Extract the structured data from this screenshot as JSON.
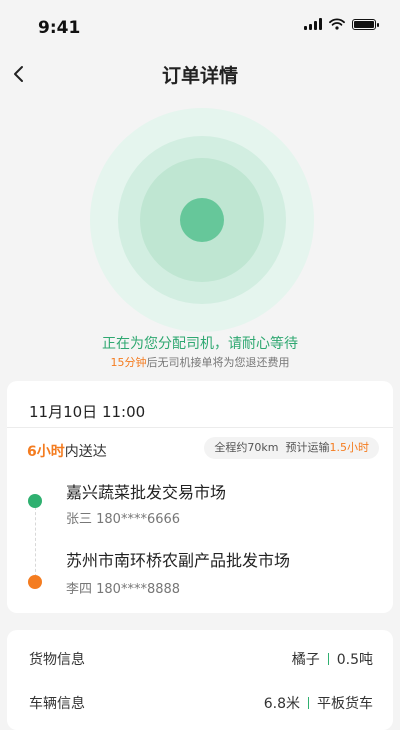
{
  "status": {
    "time": "9:41"
  },
  "nav": {
    "title": "订单详情"
  },
  "waiting": {
    "title": "正在为您分配司机，请耐心等待",
    "sub_highlight": "15分钟",
    "sub_text": "后无司机接单将为您退还费用"
  },
  "route": {
    "datetime": "11月10日  11:00",
    "deliver_highlight": "6小时",
    "deliver_text": "内送达",
    "distance_text": "全程约70km",
    "transport_label": "预计运输",
    "transport_time": "1.5小时",
    "start": {
      "name": "嘉兴蔬菜批发交易市场",
      "contact": "张三 180****6666"
    },
    "end": {
      "name": "苏州市南环桥农副产品批发市场",
      "contact": "李四 180****8888"
    }
  },
  "info": {
    "cargo": {
      "label": "货物信息",
      "type": "橘子",
      "weight": "0.5吨"
    },
    "vehicle": {
      "label": "车辆信息",
      "length": "6.8米",
      "type": "平板货车"
    }
  },
  "colors": {
    "accent_green": "#2fa871",
    "accent_orange": "#f47c20",
    "radar_center": "#66c79a"
  },
  "icons": {
    "back": "chevron-left-icon",
    "signal": "signal-icon",
    "wifi": "wifi-icon",
    "battery": "battery-icon"
  }
}
